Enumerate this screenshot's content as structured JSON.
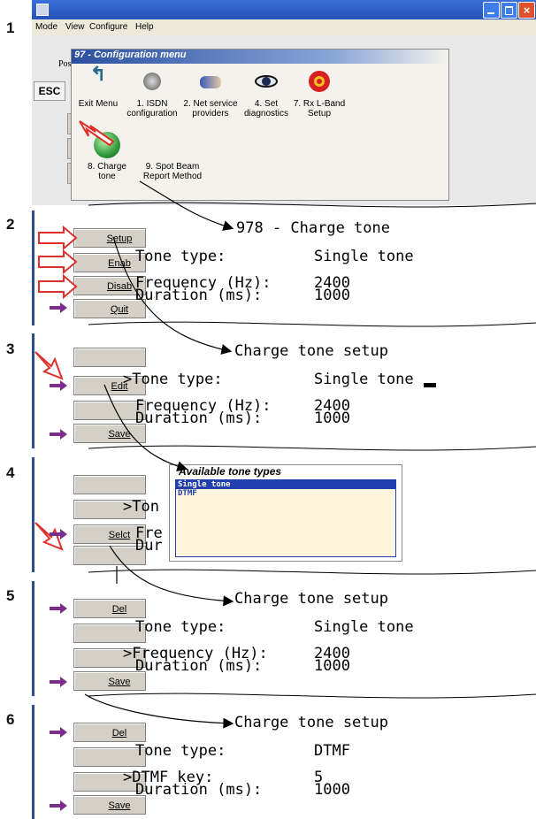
{
  "steps": [
    "1",
    "2",
    "3",
    "4",
    "5",
    "6"
  ],
  "window": {
    "menubar": [
      "Mode",
      "View",
      "Configure",
      "Help"
    ],
    "esc": "ESC",
    "posit": "Positi"
  },
  "config_menu": {
    "title": "97 - Configuration menu",
    "items": [
      {
        "label": "Exit Menu",
        "icon": "exit-arrow-icon"
      },
      {
        "label": "1. ISDN configuration",
        "icon": "phone-icon"
      },
      {
        "label": "2. Net service providers",
        "icon": "handshake-icon"
      },
      {
        "label": "4. Set diagnostics",
        "icon": "eye-icon"
      },
      {
        "label": "7. Rx L-Band Setup",
        "icon": "target-icon"
      },
      {
        "label": "8. Charge tone",
        "icon": "globe-icon"
      },
      {
        "label": "9. Spot Beam Report Method",
        "icon": ""
      }
    ]
  },
  "panel2": {
    "title": "978 - Charge tone",
    "buttons": [
      "Setup",
      "Enab",
      "Disab",
      "Quit"
    ],
    "rows": [
      [
        "Tone type:",
        "Single tone"
      ],
      [
        "Frequency (Hz):",
        "2400"
      ],
      [
        "Duration (ms):",
        "1000"
      ]
    ]
  },
  "panel3": {
    "title": "Charge tone setup",
    "edit": "Edit",
    "save": "Save",
    "rows": [
      [
        ">Tone type:",
        "Single tone"
      ],
      [
        "Frequency (Hz):",
        "2400"
      ],
      [
        "Duration (ms):",
        "1000"
      ]
    ]
  },
  "panel4": {
    "select": "Selct",
    "partial": [
      ">Ton",
      "Fre",
      "Dur"
    ],
    "popup_title": "Available tone types",
    "options": [
      "Single tone",
      "DTMF"
    ]
  },
  "panel5": {
    "title": "Charge tone setup",
    "del": "Del",
    "save": "Save",
    "rows": [
      [
        "Tone type:",
        "Single tone"
      ],
      [
        ">Frequency (Hz):",
        "2400"
      ],
      [
        "Duration (ms):",
        "1000"
      ]
    ]
  },
  "panel6": {
    "title": "Charge tone setup",
    "del": "Del",
    "save": "Save",
    "rows": [
      [
        "Tone type:",
        "DTMF"
      ],
      [
        ">DTMF key:",
        "5"
      ],
      [
        "Duration (ms):",
        "1000"
      ]
    ]
  },
  "colors": {
    "accent_arrow": "#7a2e8a",
    "red_arrow": "#e0302c",
    "window_blue": "#2d4e8c",
    "popup_bg": "#fff5dc",
    "select_blue": "#2040b0"
  }
}
